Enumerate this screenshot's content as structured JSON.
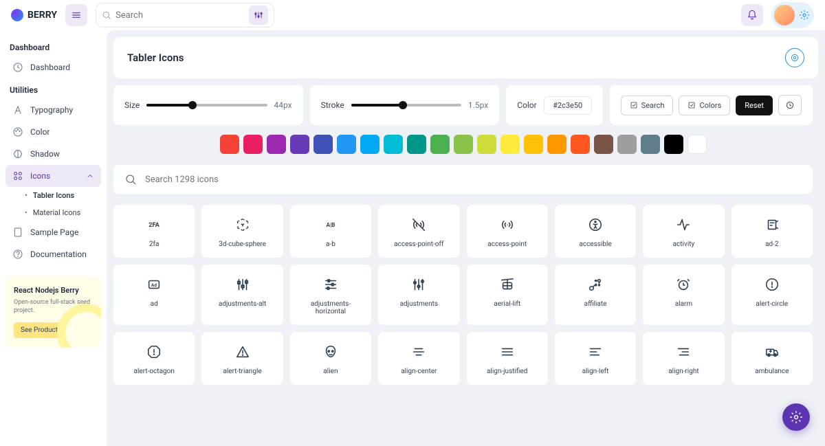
{
  "brand": "BERRY",
  "search": {
    "placeholder": "Search"
  },
  "sidebar": {
    "groups": [
      {
        "label": "Dashboard",
        "items": [
          {
            "label": "Dashboard"
          }
        ]
      },
      {
        "label": "Utilities",
        "items": [
          {
            "label": "Typography"
          },
          {
            "label": "Color"
          },
          {
            "label": "Shadow"
          },
          {
            "label": "Icons",
            "expanded": true,
            "children": [
              {
                "label": "Tabler Icons",
                "active": true
              },
              {
                "label": "Material Icons"
              }
            ]
          },
          {
            "label": "Sample Page"
          },
          {
            "label": "Documentation"
          }
        ]
      }
    ]
  },
  "promo": {
    "title": "React Nodejs Berry",
    "desc": "Open-source full-stack seed project.",
    "cta": "See Product"
  },
  "page": {
    "title": "Tabler Icons"
  },
  "controls": {
    "size": {
      "label": "Size",
      "value": "44px",
      "percent": 38
    },
    "stroke": {
      "label": "Stroke",
      "value": "1.5px",
      "percent": 47
    },
    "color": {
      "label": "Color",
      "value": "#2c3e50"
    },
    "buttons": {
      "search": "Search",
      "colors": "Colors",
      "reset": "Reset"
    }
  },
  "swatches": [
    "#f44336",
    "#e91e63",
    "#9c27b0",
    "#673ab7",
    "#3f51b5",
    "#2196f3",
    "#03a9f4",
    "#00bcd4",
    "#009688",
    "#4caf50",
    "#8bc34a",
    "#cddc39",
    "#ffeb3b",
    "#ffc107",
    "#ff9800",
    "#ff5722",
    "#795548",
    "#9e9e9e",
    "#607d8b",
    "#000000",
    "#ffffff"
  ],
  "iconSearch": {
    "placeholder": "Search 1298 icons"
  },
  "icons": [
    "2fa",
    "3d-cube-sphere",
    "a-b",
    "access-point-off",
    "access-point",
    "accessible",
    "activity",
    "ad-2",
    "ad",
    "adjustments-alt",
    "adjustments-horizontal",
    "adjustments",
    "aerial-lift",
    "affiliate",
    "alarm",
    "alert-circle",
    "alert-octagon",
    "alert-triangle",
    "alien",
    "align-center",
    "align-justified",
    "align-left",
    "align-right",
    "ambulance"
  ]
}
